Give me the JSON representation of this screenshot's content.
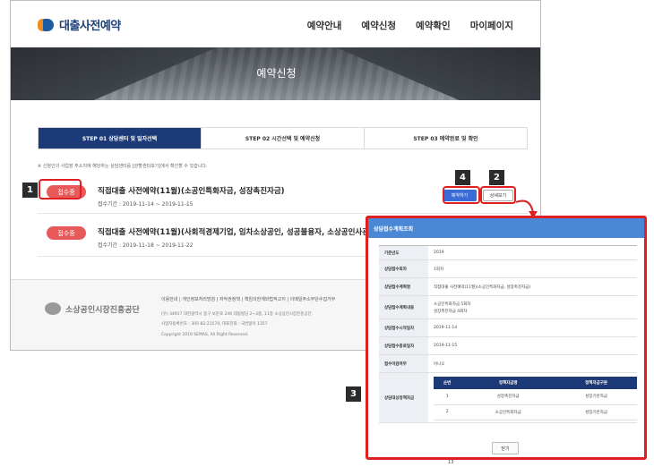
{
  "header": {
    "logo_text": "대출사전예약",
    "nav": [
      "예약안내",
      "예약신청",
      "예약확인",
      "마이페이지"
    ]
  },
  "hero": {
    "title": "예약신청"
  },
  "steps": [
    "STEP 01 상담센터 및 일자선택",
    "STEP 02 시간선택 및 예약신청",
    "STEP 03 예약완료 및 확인"
  ],
  "notice": "※ 신청인의 사업장 주소지에 해당하는 상담센터를 [관할센터보기]에서 확인할 수 있습니다.",
  "list": [
    {
      "badge": "접수중",
      "title": "직접대출 사전예약(11월)(소공인특화자금, 성장촉진자금)",
      "period": "접수기간 : 2019-11-14 ~ 2019-11-15",
      "apply_label": "예약하기",
      "detail_label": "상세보기"
    },
    {
      "badge": "접수중",
      "title": "직접대출 사전예약(11월)(사회적경제기업, 임차소상공인, 성공불융자, 소상공인사관학교)",
      "period": "접수기간 : 2019-11-18 ~ 2019-11-22"
    }
  ],
  "footer": {
    "org": "소상공인시장진흥공단",
    "links": "이용안내 | 개인정보처리방침 | 저작권정책 | 책임의한계와법적고지 | 이메일주소무단수집거부",
    "address": "(우) 34917 대전광역시 중구 보문로 246 대림빌딩 2~3층, 11층 소상공인시장진흥공단.",
    "biz": "사업자등록번호 : 305-82-21570, 대표전화 : 국번없이 1357",
    "copyright": "Copyright 2019 SEMAS, All Right Reserved."
  },
  "markers": {
    "m1": "1",
    "m2": "2",
    "m3": "3",
    "m4": "4"
  },
  "modal": {
    "title": "상담접수계획조회",
    "fields": [
      {
        "label": "기준년도",
        "value": "2019"
      },
      {
        "label": "상담접수회차",
        "value": "1회차"
      },
      {
        "label": "상담접수계획명",
        "value": "직접대출 사전예약(11월)(소공인특화자금, 성장촉진자금)"
      },
      {
        "label": "상담접수계획내용",
        "value": "소공인특화자금 5회차",
        "value2": "성장촉진자금 4회차"
      },
      {
        "label": "상담접수시작일자",
        "value": "2019-11-14"
      },
      {
        "label": "상담접수종료일자",
        "value": "2019-11-15"
      },
      {
        "label": "접수마감여부",
        "value": "아니오"
      }
    ],
    "policy_label": "상담대상정책자금",
    "table": {
      "headers": [
        "순번",
        "정책자금명",
        "정책자금구분"
      ],
      "rows": [
        [
          "1",
          "성장촉진자금",
          "성장기반자금"
        ],
        [
          "2",
          "소공인특화자금",
          "성장기반자금"
        ]
      ]
    },
    "close_label": "닫기"
  },
  "page_number": "13"
}
